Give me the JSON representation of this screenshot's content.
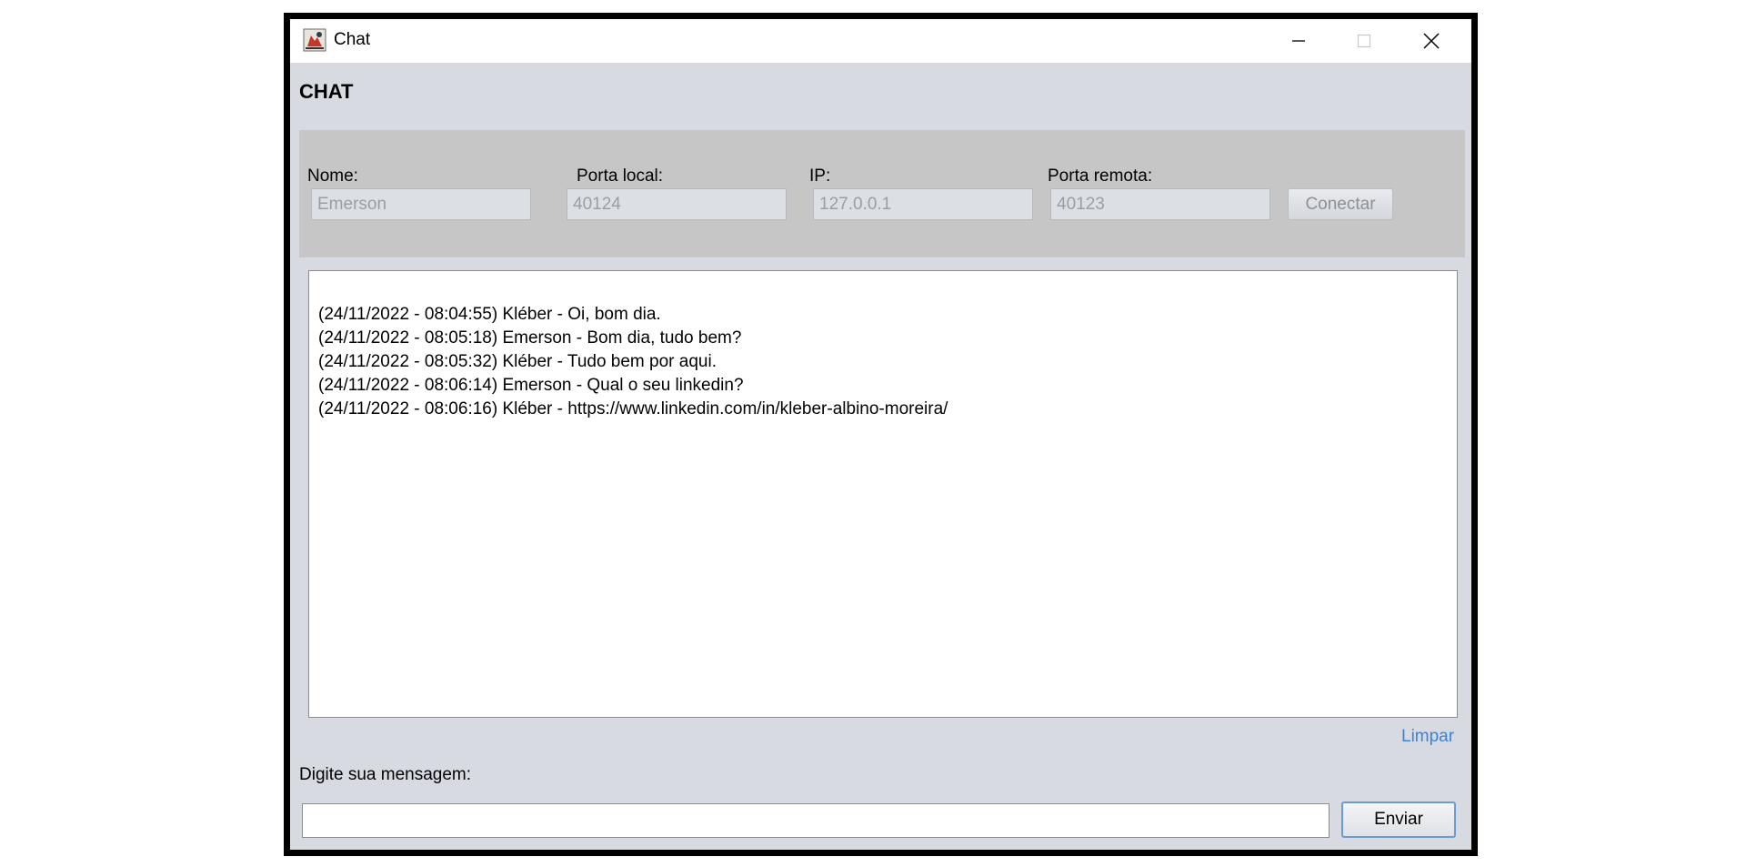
{
  "window": {
    "title": "Chat",
    "icon": "java-app-icon"
  },
  "heading": "CHAT",
  "connection": {
    "name_label": "Nome:",
    "name_value": "Emerson",
    "local_port_label": "Porta local:",
    "local_port_value": "40124",
    "ip_label": "IP:",
    "ip_value": "127.0.0.1",
    "remote_port_label": "Porta remota:",
    "remote_port_value": "40123",
    "connect_label": "Conectar"
  },
  "messages": [
    "(24/11/2022 - 08:04:55) Kléber - Oi, bom dia.",
    "(24/11/2022 - 08:05:18) Emerson - Bom dia, tudo bem?",
    "(24/11/2022 - 08:05:32) Kléber - Tudo bem por aqui.",
    "(24/11/2022 - 08:06:14) Emerson - Qual o seu linkedin?",
    "(24/11/2022 - 08:06:16) Kléber - https://www.linkedin.com/in/kleber-albino-moreira/"
  ],
  "clear_label": "Limpar",
  "compose": {
    "label": "Digite sua mensagem:",
    "value": "",
    "send_label": "Enviar"
  },
  "colors": {
    "window_bg": "#d7dae1",
    "panel_bg": "#c6c6c6",
    "link": "#3d82d6",
    "button_focus_border": "#6b9bd3"
  }
}
